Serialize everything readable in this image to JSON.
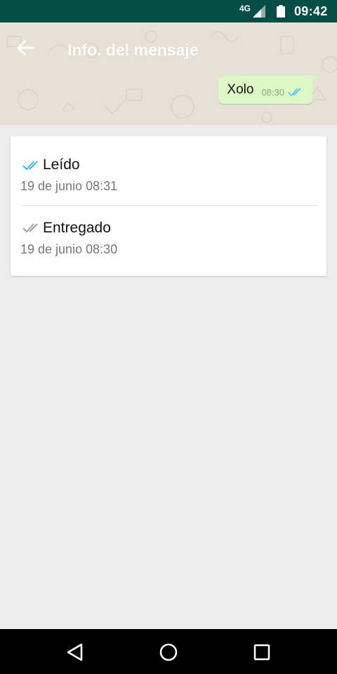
{
  "status_bar": {
    "network": "4G",
    "time": "09:42"
  },
  "header": {
    "title": "Info. del mensaje",
    "back_icon": "arrow-left-icon"
  },
  "message": {
    "text": "Xolo",
    "time": "08:30",
    "tick_icon": "double-check-icon",
    "tick_color": "#4fc3f7"
  },
  "receipts": [
    {
      "label": "Leído",
      "time": "19 de junio 08:31",
      "icon": "double-check-icon",
      "icon_color": "#34b7f1"
    },
    {
      "label": "Entregado",
      "time": "19 de junio 08:30",
      "icon": "double-check-icon",
      "icon_color": "#9e9e9e"
    }
  ],
  "colors": {
    "status_bar": "#054d44",
    "bubble": "#dcf8c6",
    "background": "#ececec"
  },
  "nav_bar": {
    "back_icon": "triangle-back-icon",
    "home_icon": "circle-home-icon",
    "recent_icon": "square-recents-icon"
  }
}
